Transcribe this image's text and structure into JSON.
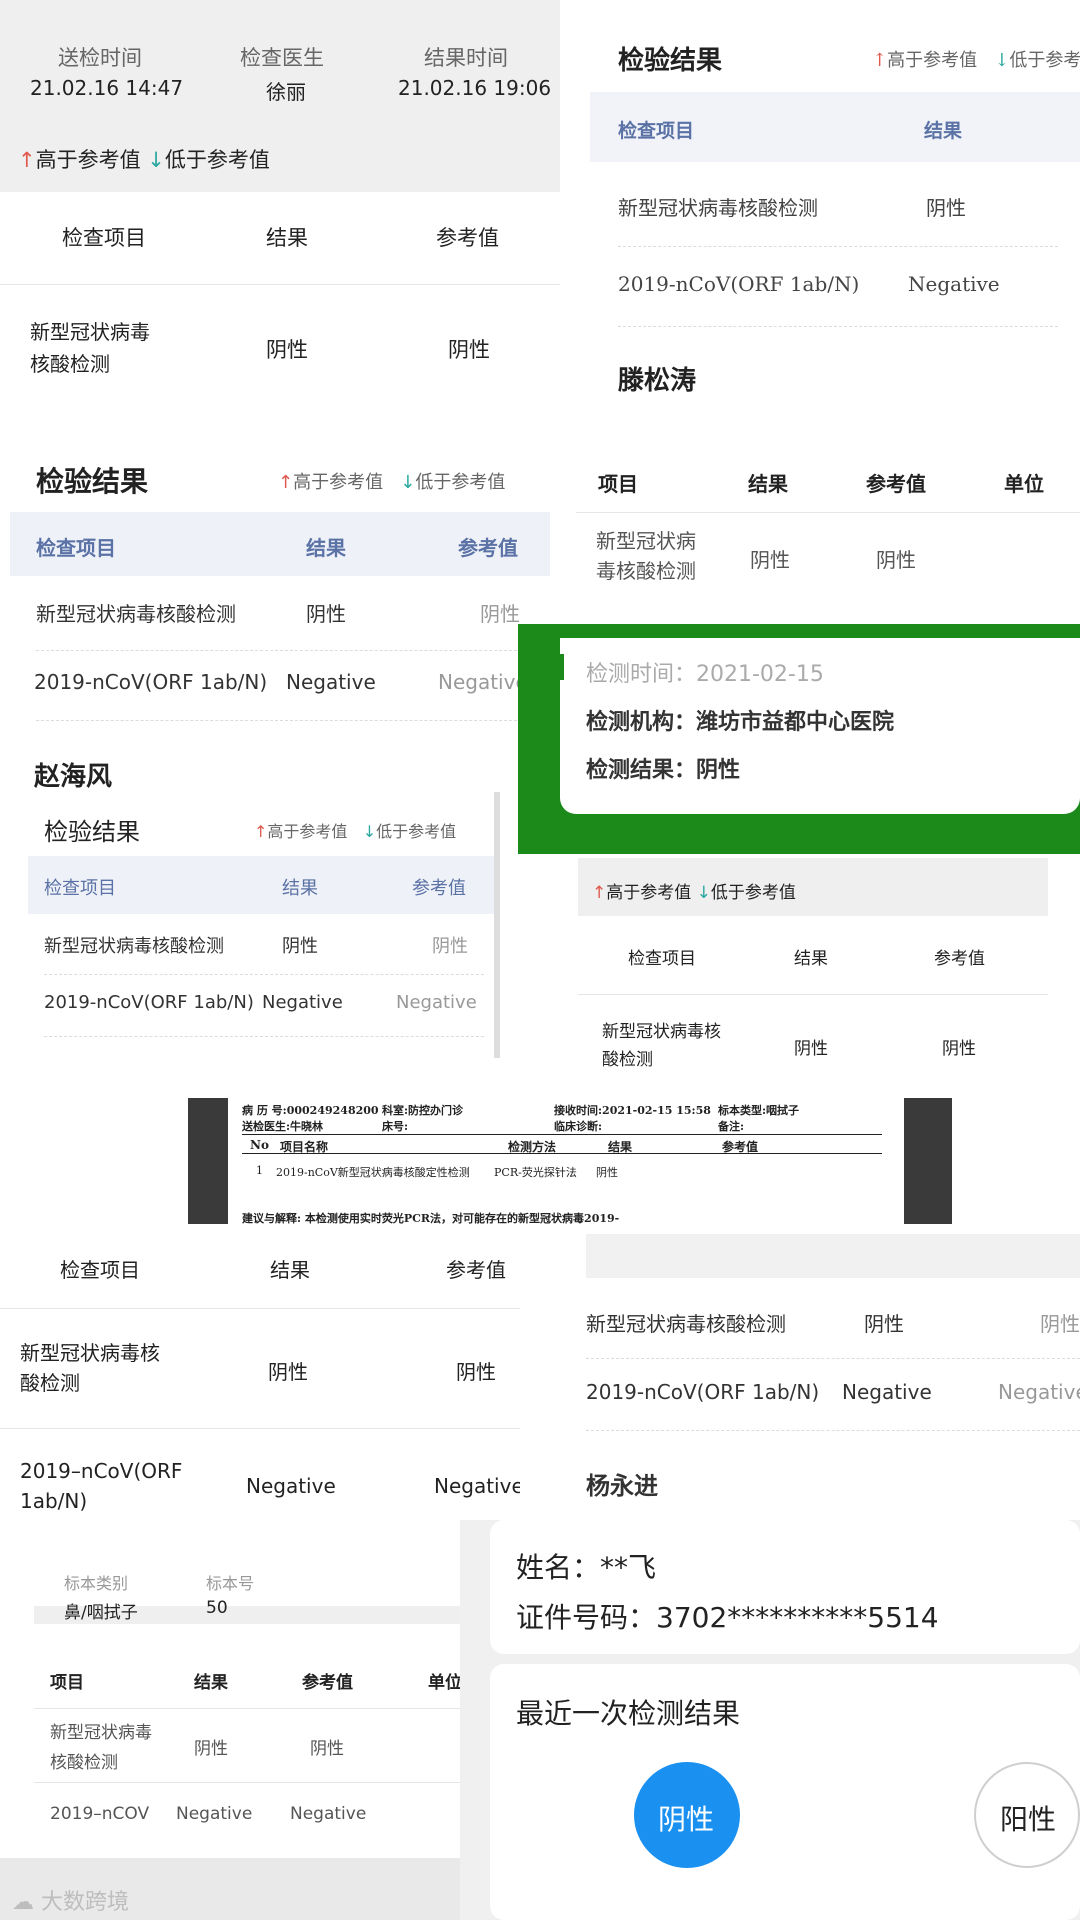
{
  "legend": {
    "up": "高于参考值",
    "down": "低于参考值",
    "up_arrow": "↑",
    "down_arrow": "↓"
  },
  "panel_a": {
    "col1_label": "送检时间",
    "col1_value": "21.02.16 14:47",
    "col2_label": "检查医生",
    "col2_value": "徐丽",
    "col3_label": "结果时间",
    "col3_value": "21.02.16 19:06",
    "headers": [
      "检查项目",
      "结果",
      "参考值"
    ],
    "row_item": "新型冠状病毒\n核酸检测",
    "row_result": "阴性",
    "row_ref": "阴性"
  },
  "panel_b": {
    "title": "检验结果",
    "headers": [
      "检查项目",
      "结果"
    ],
    "rows": [
      [
        "新型冠状病毒核酸检测",
        "阴性"
      ],
      [
        "2019-nCoV(ORF 1ab/N)",
        "Negative"
      ]
    ],
    "name": "滕松涛"
  },
  "panel_c": {
    "title": "检验结果",
    "headers": [
      "检查项目",
      "结果",
      "参考值"
    ],
    "rows": [
      [
        "新型冠状病毒核酸检测",
        "阴性",
        "阴性"
      ],
      [
        "2019-nCoV(ORF 1ab/N)",
        "Negative",
        "Negative"
      ]
    ],
    "name": "赵海风"
  },
  "panel_d": {
    "headers": [
      "项目",
      "结果",
      "参考值",
      "单位"
    ],
    "row_item": "新型冠状病\n毒核酸检测",
    "row_result": "阴性",
    "row_ref": "阴性"
  },
  "panel_e": {
    "line1": "检测时间：2021-02-15",
    "line2": "检测机构：潍坊市益都中心医院",
    "line3": "检测结果：阴性"
  },
  "panel_f": {
    "title": "检验结果",
    "headers": [
      "检查项目",
      "结果",
      "参考值"
    ],
    "rows": [
      [
        "新型冠状病毒核酸检测",
        "阴性",
        "阴性"
      ],
      [
        "2019-nCoV(ORF 1ab/N)",
        "Negative",
        "Negative"
      ]
    ]
  },
  "panel_g": {
    "headers": [
      "检查项目",
      "结果",
      "参考值"
    ],
    "row_item": "新型冠状病毒核\n酸检测",
    "row_result": "阴性",
    "row_ref": "阴性"
  },
  "panel_h": {
    "line1a": "病 历 号:000249248200",
    "line1b": "科室:防控办门诊",
    "line1c": "接收时间:2021-02-15 15:58",
    "line1d": "标本类型:咽拭子",
    "line2a": "送检医生:牛晓林",
    "line2b": "床号:",
    "line2c": "临床诊断:",
    "line2d": "备注:",
    "head_no": "No",
    "head_name": "项目名称",
    "head_method": "检测方法",
    "head_result": "结果",
    "head_ref": "参考值",
    "row_no": "1",
    "row_name": "2019-nCoV新型冠状病毒核酸定性检测",
    "row_method": "PCR-荧光探针法",
    "row_result": "阴性",
    "footer": "建议与解释:  本检测使用实时荧光PCR法，对可能存在的新型冠状病毒2019-"
  },
  "panel_i": {
    "headers": [
      "检查项目",
      "结果",
      "参考值"
    ],
    "row1_item": "新型冠状病毒核\n酸检测",
    "row1_result": "阴性",
    "row1_ref": "阴性",
    "row2_item": "2019–nCoV(ORF\n1ab/N)",
    "row2_result": "Negative",
    "row2_ref": "Negative"
  },
  "panel_j": {
    "rows": [
      [
        "新型冠状病毒核酸检测",
        "阴性",
        "阴性"
      ],
      [
        "2019-nCoV(ORF 1ab/N)",
        "Negative",
        "Negative"
      ]
    ],
    "name": "杨永进"
  },
  "panel_k": {
    "label1": "标本类别",
    "value1": "鼻/咽拭子",
    "label2": "标本号",
    "value2": "50",
    "headers": [
      "项目",
      "结果",
      "参考值",
      "单位"
    ],
    "row1_item": "新型冠状病毒\n核酸检测",
    "row1_result": "阴性",
    "row1_ref": "阴性",
    "row2_item": "2019–nCOV",
    "row2_result": "Negative",
    "row2_ref": "Negative"
  },
  "panel_l": {
    "name_line": "姓名：**飞",
    "id_line": "证件号码：3702**********5514",
    "latest": "最近一次检测结果",
    "negative": "阴性",
    "positive": "阳性"
  },
  "watermark": "大数跨境",
  "colors": {
    "green": "#1b8a1b",
    "blue_header": "#5b72a6",
    "up": "#e05a4e",
    "down": "#2aa8a0",
    "circle_blue": "#1a90f0"
  }
}
